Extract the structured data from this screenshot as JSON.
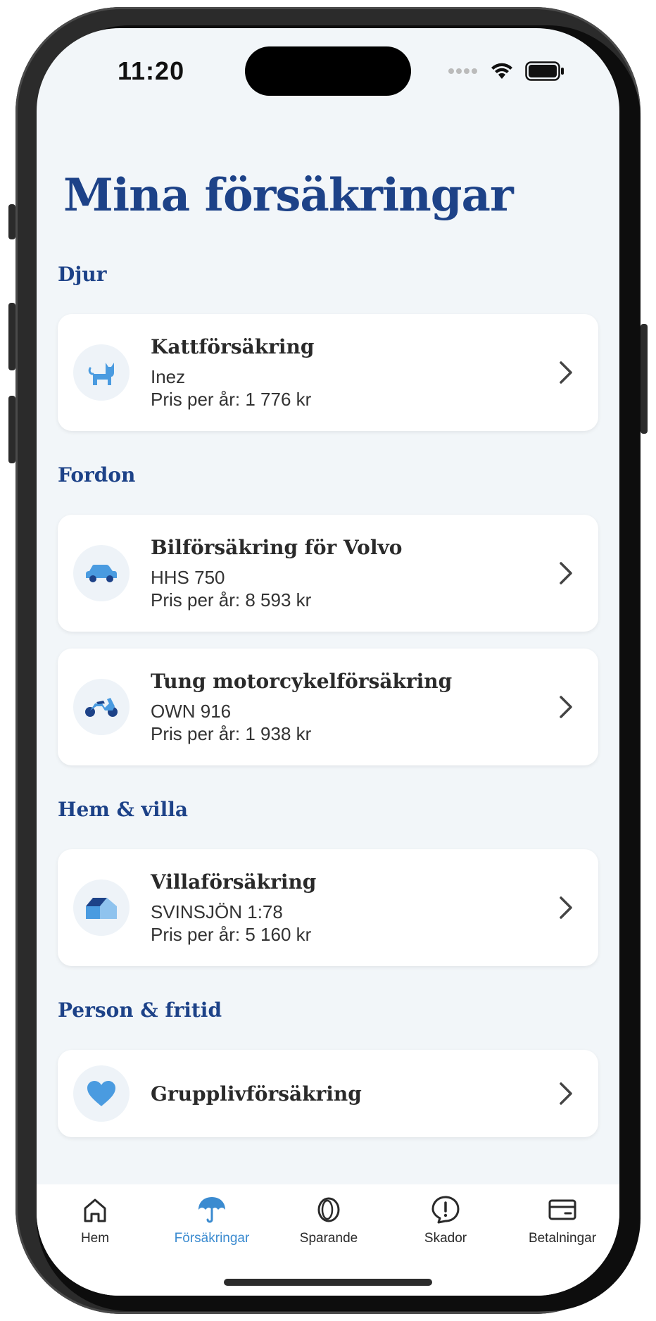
{
  "status": {
    "time": "11:20"
  },
  "page": {
    "title": "Mina försäkringar"
  },
  "sections": [
    {
      "name": "Djur"
    },
    {
      "name": "Fordon"
    },
    {
      "name": "Hem & villa"
    },
    {
      "name": "Person & fritid"
    }
  ],
  "cards": [
    {
      "title": "Kattförsäkring",
      "line1": "Inez",
      "line2": "Pris per år: 1 776 kr",
      "icon": "cat-icon"
    },
    {
      "title": "Bilförsäkring för Volvo",
      "line1": "HHS 750",
      "line2": "Pris per år: 8 593 kr",
      "icon": "car-icon"
    },
    {
      "title": "Tung motorcykelförsäkring",
      "line1": "OWN 916",
      "line2": "Pris per år: 1 938 kr",
      "icon": "motorcycle-icon"
    },
    {
      "title": "Villaförsäkring",
      "line1": "SVINSJÖN 1:78",
      "line2": "Pris per år: 5 160 kr",
      "icon": "house-icon"
    },
    {
      "title": "Grupplivförsäkring",
      "icon": "heart-icon"
    }
  ],
  "tabs": [
    {
      "label": "Hem",
      "icon": "home-icon"
    },
    {
      "label": "Försäkringar",
      "icon": "umbrella-icon",
      "active": true
    },
    {
      "label": "Sparande",
      "icon": "coin-icon"
    },
    {
      "label": "Skador",
      "icon": "alert-icon"
    },
    {
      "label": "Betalningar",
      "icon": "card-icon"
    }
  ],
  "colors": {
    "brand": "#1d4288",
    "accent": "#3b8bd0",
    "icon": "#4a9be0",
    "background": "#f2f6f9"
  }
}
